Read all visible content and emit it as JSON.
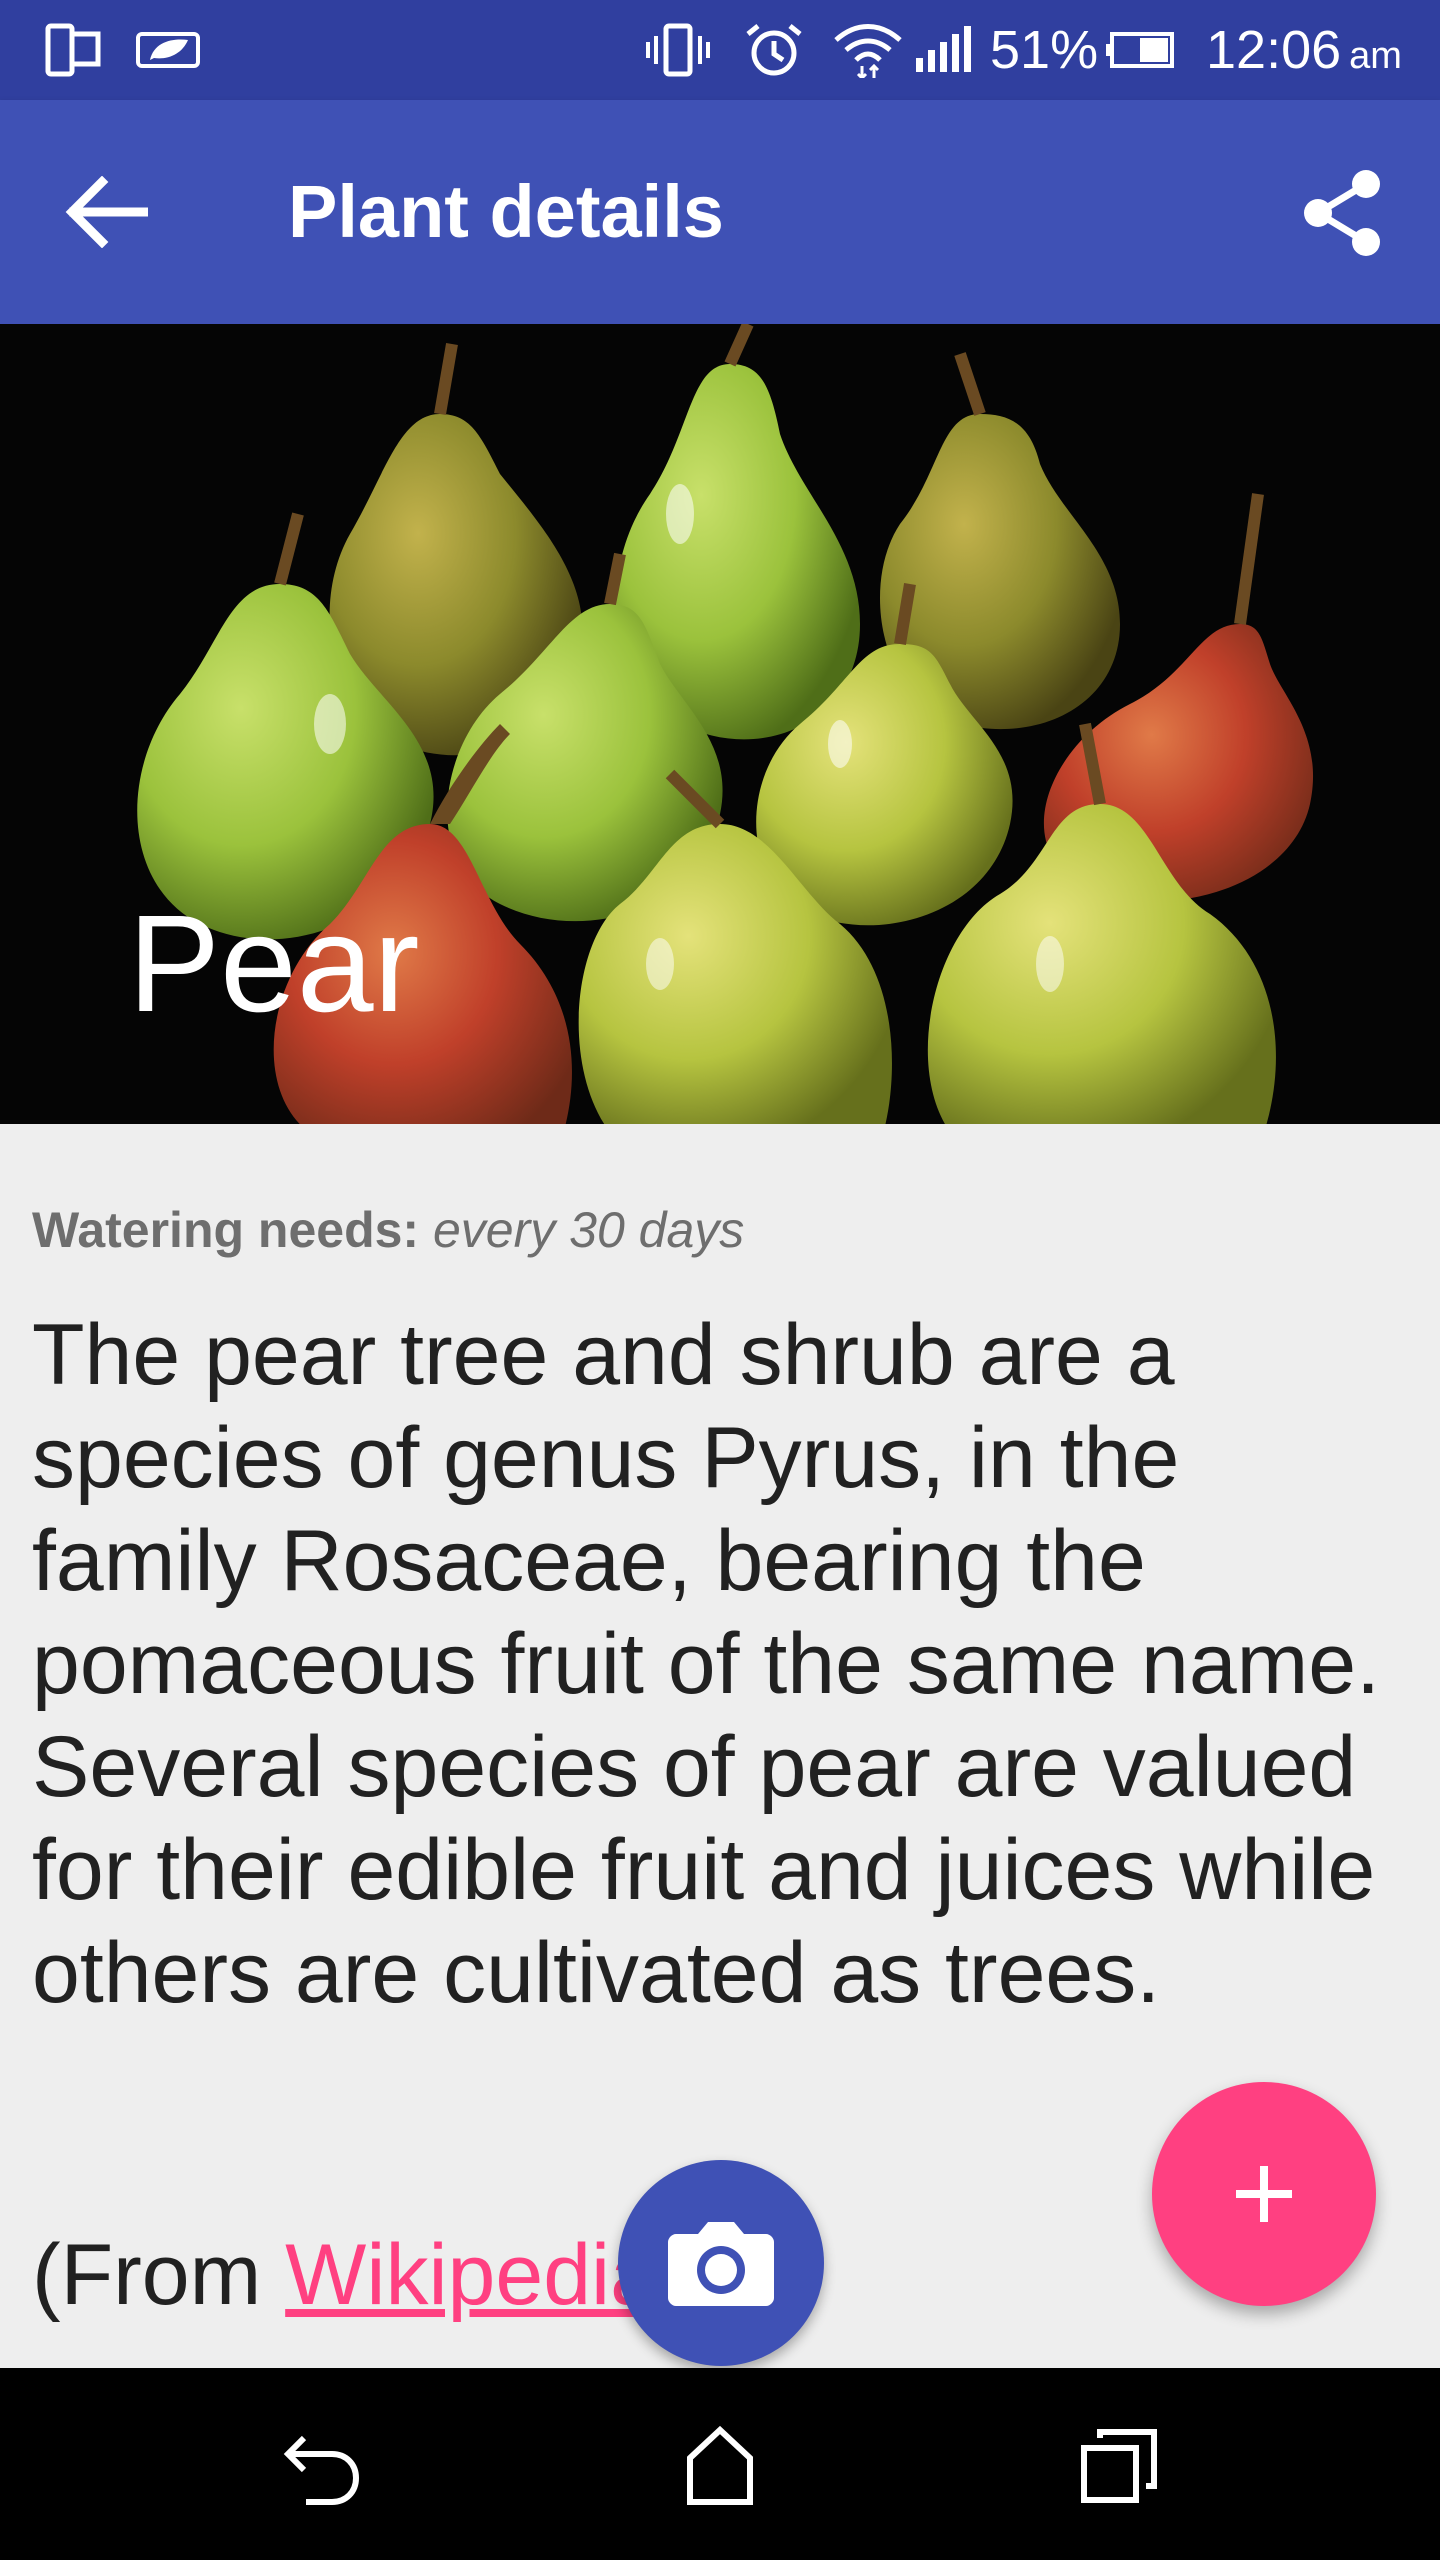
{
  "status_bar": {
    "battery_percent": "51%",
    "time": "12:06",
    "am_pm": "am",
    "icons": [
      "screen-mirror-icon",
      "leaf-notification-icon",
      "vibrate-icon",
      "alarm-icon",
      "wifi-icon",
      "signal-icon",
      "battery-icon"
    ]
  },
  "toolbar": {
    "title": "Plant details",
    "back_icon": "arrow-back-icon",
    "share_icon": "share-icon"
  },
  "plant": {
    "name": "Pear",
    "watering_label": "Watering needs:",
    "watering_value": "every 30 days",
    "description": "The pear tree and shrub are a species of genus Pyrus, in the family Rosaceae, bearing the pomaceous fruit of the same name. Several species of pear are valued for their edible fruit and juices while others are cultivated as trees.",
    "source_prefix": "(From ",
    "source_link": "Wikipedia"
  },
  "fab": {
    "add_icon": "plus-icon",
    "camera_icon": "camera-icon"
  },
  "navigation": {
    "icons": [
      "back-icon",
      "home-icon",
      "recents-icon"
    ]
  },
  "colors": {
    "primary": "#3f51b5",
    "primary_dark": "#303f9f",
    "accent": "#ff4081",
    "background": "#eeeeee"
  }
}
